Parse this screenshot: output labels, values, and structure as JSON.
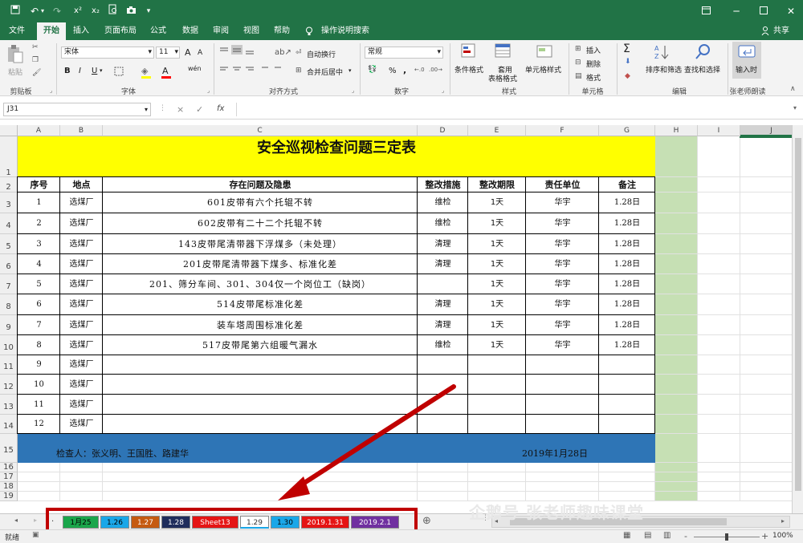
{
  "titlebar": {
    "quick_access": [
      "save-icon",
      "undo-icon",
      "redo-icon",
      "superscript-icon",
      "subscript-icon",
      "print-preview-icon",
      "camera-icon",
      "customize-icon"
    ],
    "labels": {
      "x2sup": "x²",
      "x2sub": "x₂"
    }
  },
  "ribbon_tabs": [
    "文件",
    "开始",
    "插入",
    "页面布局",
    "公式",
    "数据",
    "审阅",
    "视图",
    "帮助",
    "操作说明搜索"
  ],
  "share_label": "共享",
  "ribbon": {
    "clipboard": {
      "paste": "粘贴",
      "label": "剪贴板"
    },
    "font": {
      "name": "宋体",
      "size": "11",
      "label": "字体",
      "bold": "B",
      "italic": "I",
      "underline": "U",
      "grow": "A",
      "shrink": "A",
      "fontcolor": "A",
      "phonetic": "wén"
    },
    "align": {
      "wrap": "自动换行",
      "merge": "合并后居中",
      "label": "对齐方式"
    },
    "number": {
      "format": "常规",
      "label": "数字",
      "percent": "%",
      "comma": ","
    },
    "styles": {
      "cond": "条件格式",
      "table1": "套用",
      "table2": "表格格式",
      "cell": "单元格样式",
      "label": "样式"
    },
    "cells": {
      "insert": "插入",
      "delete": "删除",
      "format": "格式",
      "label": "单元格"
    },
    "editing": {
      "sum": "Σ",
      "sort": "排序和筛选",
      "find": "查找和选择",
      "label": "编辑"
    },
    "custom": {
      "btn": "输入时",
      "label": "张老师朗读"
    }
  },
  "formula_bar": {
    "namebox": "J31",
    "cancel": "×",
    "enter": "✓",
    "fx": "fx",
    "formula": ""
  },
  "columns": [
    "A",
    "B",
    "C",
    "D",
    "E",
    "F",
    "G",
    "H",
    "I",
    "J"
  ],
  "rows": [
    "1",
    "2",
    "3",
    "4",
    "5",
    "6",
    "7",
    "8",
    "9",
    "10",
    "11",
    "12",
    "13",
    "14",
    "15",
    "16",
    "17",
    "18",
    "19"
  ],
  "sheet": {
    "title": "安全巡视检查问题三定表",
    "headers": [
      "序号",
      "地点",
      "存在问题及隐患",
      "整改措施",
      "整改期限",
      "责任单位",
      "备注"
    ],
    "data": [
      [
        "1",
        "选煤厂",
        "601皮带有六个托辊不转",
        "维检",
        "1天",
        "华宇",
        "1.28日"
      ],
      [
        "2",
        "选煤厂",
        "602皮带有二十二个托辊不转",
        "维检",
        "1天",
        "华宇",
        "1.28日"
      ],
      [
        "3",
        "选煤厂",
        "143皮带尾清带器下浮煤多（未处理）",
        "清理",
        "1天",
        "华宇",
        "1.28日"
      ],
      [
        "4",
        "选煤厂",
        "201皮带尾清带器下煤多、标准化差",
        "清理",
        "1天",
        "华宇",
        "1.28日"
      ],
      [
        "5",
        "选煤厂",
        "201、筛分车间、301、304仅一个岗位工（缺岗）",
        "",
        "1天",
        "华宇",
        "1.28日"
      ],
      [
        "6",
        "选煤厂",
        "514皮带尾标准化差",
        "清理",
        "1天",
        "华宇",
        "1.28日"
      ],
      [
        "7",
        "选煤厂",
        "装车塔周围标准化差",
        "清理",
        "1天",
        "华宇",
        "1.28日"
      ],
      [
        "8",
        "选煤厂",
        "517皮带尾第六组暖气漏水",
        "维检",
        "1天",
        "华宇",
        "1.28日"
      ],
      [
        "9",
        "选煤厂",
        "",
        "",
        "",
        "",
        ""
      ],
      [
        "10",
        "选煤厂",
        "",
        "",
        "",
        "",
        ""
      ],
      [
        "11",
        "选煤厂",
        "",
        "",
        "",
        "",
        ""
      ],
      [
        "12",
        "选煤厂",
        "",
        "",
        "",
        "",
        ""
      ]
    ],
    "footer_left": "检查人：张义明、王国胜、路建华",
    "footer_right": "2019年1月28日"
  },
  "sheet_tabs": [
    {
      "label": "1月25",
      "bg": "#1aa64b",
      "fg": "#000"
    },
    {
      "label": "1.26",
      "bg": "#1aa7e8",
      "fg": "#000"
    },
    {
      "label": "1.27",
      "bg": "#c55a11",
      "fg": "#fff"
    },
    {
      "label": "1.28",
      "bg": "#1f2d5c",
      "fg": "#fff"
    },
    {
      "label": "Sheet13",
      "bg": "#e51414",
      "fg": "#fff"
    },
    {
      "label": "1.29",
      "bg": "#ffffff",
      "fg": "#333"
    },
    {
      "label": "1.30",
      "bg": "#1aa7e8",
      "fg": "#000"
    },
    {
      "label": "2019.1.31",
      "bg": "#e51414",
      "fg": "#fff"
    },
    {
      "label": "2019.2.1",
      "bg": "#7030a0",
      "fg": "#fff"
    }
  ],
  "sheet_add": "⊕",
  "sheet_ellipsis": ".",
  "watermark": "企鹅号 张老师趣味课堂",
  "status": {
    "ready": "就绪",
    "zoom": "100%",
    "minus": "-",
    "plus": "+"
  },
  "colors": {
    "excel_green": "#217346",
    "title_fill": "#ffff00",
    "footer_fill": "#2e75b6",
    "h_col_fill": "#c6e0b4",
    "arrow": "#c00000"
  }
}
